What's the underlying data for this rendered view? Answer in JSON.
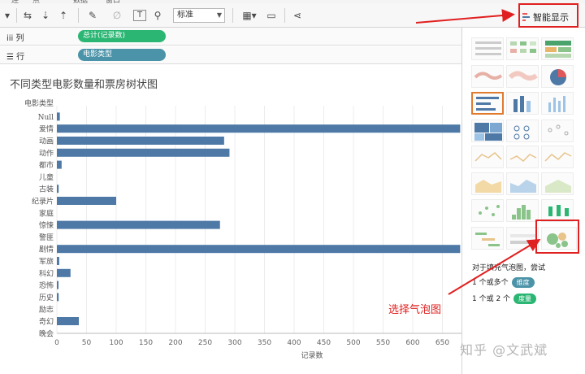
{
  "menu_strip": [
    "连",
    "点",
    "数据",
    "窗口"
  ],
  "toolbar": {
    "fit_value": "标准",
    "smart_label": "智能显示",
    "smart_icon": "show-me-icon"
  },
  "shelves": {
    "columns_label": "列",
    "columns_pill": "总计(记录数)",
    "rows_label": "行",
    "rows_pill": "电影类型"
  },
  "colors": {
    "bar": "#4e79a7",
    "measure_pill": "#2bb673",
    "dimension_pill": "#4b93a8",
    "annotation": "#e02020"
  },
  "chart_data": {
    "type": "bar",
    "orientation": "horizontal",
    "title": "不同类型电影数量和票房树状图",
    "ylabel": "电影类型",
    "xlabel": "记录数",
    "categories": [
      "Null",
      "爱情",
      "动画",
      "动作",
      "都市",
      "儿童",
      "古装",
      "纪录片",
      "家庭",
      "惊悚",
      "警匪",
      "剧情",
      "军旅",
      "科幻",
      "恐怖",
      "历史",
      "励志",
      "奇幻",
      "晚会"
    ],
    "values": [
      5,
      680,
      282,
      291,
      8,
      0,
      3,
      100,
      0,
      275,
      0,
      680,
      4,
      23,
      1,
      3,
      0,
      37,
      0
    ],
    "xlim": [
      0,
      680
    ],
    "xticks": [
      0,
      50,
      100,
      150,
      200,
      250,
      300,
      350,
      400,
      450,
      500,
      550,
      600,
      650
    ],
    "grid": true
  },
  "showme": {
    "hint": "对于填充气泡图，尝试",
    "req_dims": "1 个或多个",
    "req_dims_pill": "维度",
    "req_meas": "1 个或 2 个",
    "req_meas_pill": "度量"
  },
  "annotation": {
    "text": "选择气泡图"
  },
  "watermark": "知乎 @文武斌"
}
